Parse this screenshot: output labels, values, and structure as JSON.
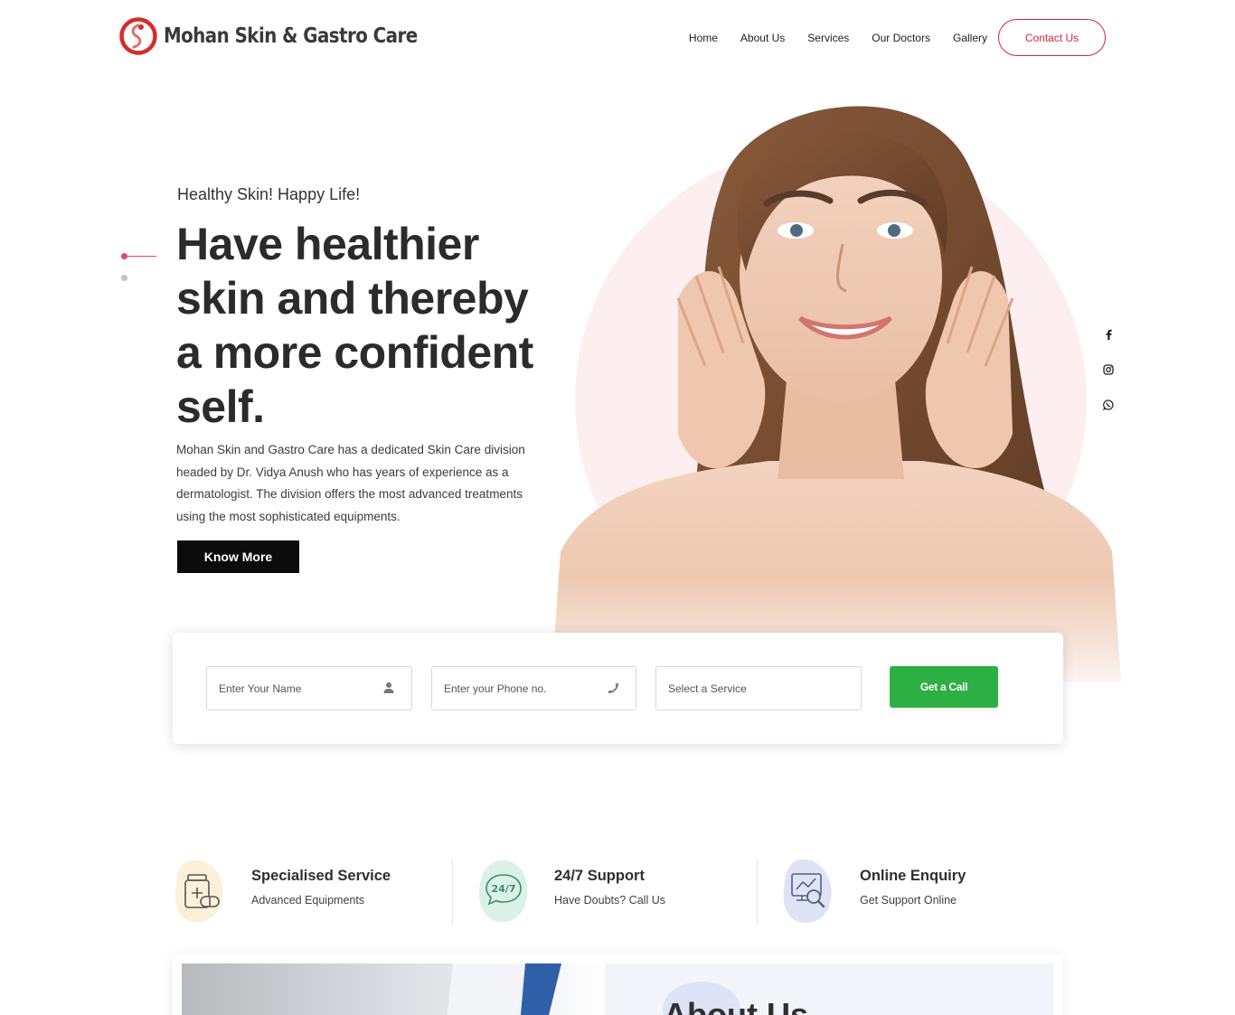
{
  "brand": {
    "name": "Mohan Skin & Gastro Care",
    "accent_color": "#d3263f"
  },
  "nav": {
    "items": [
      "Home",
      "About Us",
      "Services",
      "Our Doctors",
      "Gallery"
    ],
    "contact_label": "Contact Us"
  },
  "hero": {
    "tagline": "Healthy Skin! Happy Life!",
    "headline": "Have healthier skin and thereby a more confident self.",
    "description": "Mohan Skin and Gastro Care has a dedicated Skin Care division headed by Dr. Vidya Anush who has years of experience as a dermatologist. The division offers the most advanced treatments using the most sophisticated equipments.",
    "cta_label": "Know More",
    "slide_count": 2,
    "active_slide": 1
  },
  "social": [
    "facebook-icon",
    "instagram-icon",
    "whatsapp-icon"
  ],
  "enquiry": {
    "name_placeholder": "Enter Your Name",
    "phone_placeholder": "Enter your Phone no.",
    "service_placeholder": "Select a Service",
    "submit_label": "Get a Call",
    "submit_color": "#2db043"
  },
  "features": [
    {
      "title": "Specialised Service",
      "subtitle": "Advanced Equipments",
      "icon": "medicine-icon",
      "color": "#fdf0d8"
    },
    {
      "title": "24/7 Support",
      "subtitle": "Have Doubts? Call Us",
      "icon": "support-24-7-icon",
      "color": "#d9f1e6"
    },
    {
      "title": "Online Enquiry",
      "subtitle": "Get Support Online",
      "icon": "online-enquiry-icon",
      "color": "#dfe3f6"
    }
  ],
  "about": {
    "title": "About Us"
  }
}
